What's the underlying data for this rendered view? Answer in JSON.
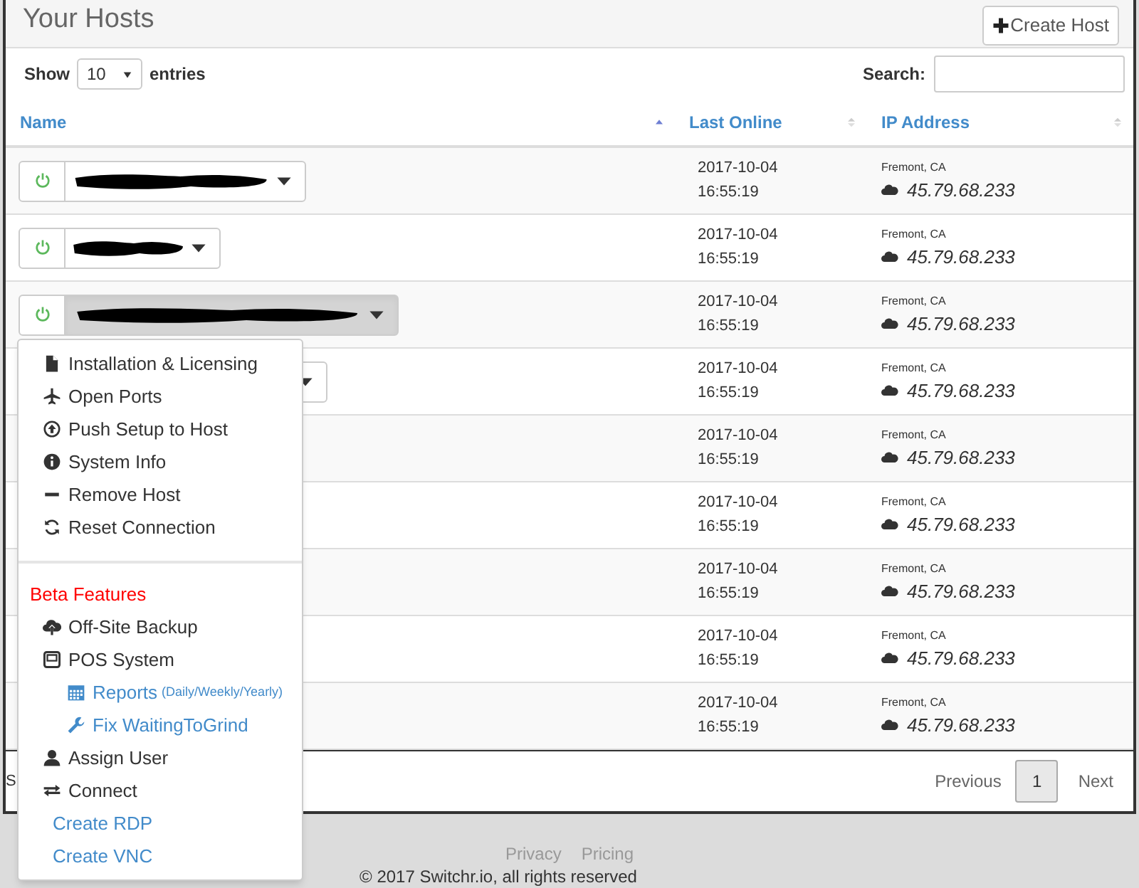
{
  "title": "Your Hosts",
  "create_button": {
    "label": "Create Host"
  },
  "length_control": {
    "before": "Show",
    "value": "10",
    "after": "entries"
  },
  "search": {
    "label": "Search:"
  },
  "table": {
    "columns": [
      {
        "label": "Name",
        "sorted": true
      },
      {
        "label": "Last Online",
        "sorted": false
      },
      {
        "label": "IP Address",
        "sorted": false
      }
    ],
    "rows": [
      {
        "kind": "button",
        "expanded": false,
        "date": "2017-10-04",
        "time": "16:55:19",
        "location": "Fremont, CA",
        "ip": "45.79.68.233"
      },
      {
        "kind": "button",
        "expanded": false,
        "date": "2017-10-04",
        "time": "16:55:19",
        "location": "Fremont, CA",
        "ip": "45.79.68.233"
      },
      {
        "kind": "button",
        "expanded": true,
        "date": "2017-10-04",
        "time": "16:55:19",
        "location": "Fremont, CA",
        "ip": "45.79.68.233"
      },
      {
        "kind": "covered_button",
        "date": "2017-10-04",
        "time": "16:55:19",
        "location": "Fremont, CA",
        "ip": "45.79.68.233"
      },
      {
        "date": "2017-10-04",
        "time": "16:55:19",
        "location": "Fremont, CA",
        "ip": "45.79.68.233"
      },
      {
        "date": "2017-10-04",
        "time": "16:55:19",
        "location": "Fremont, CA",
        "ip": "45.79.68.233"
      },
      {
        "date": "2017-10-04",
        "time": "16:55:19",
        "location": "Fremont, CA",
        "ip": "45.79.68.233"
      },
      {
        "date": "2017-10-04",
        "time": "16:55:19",
        "location": "Fremont, CA",
        "ip": "45.79.68.233"
      },
      {
        "date": "2017-10-04",
        "time": "16:55:19",
        "location": "Fremont, CA",
        "ip": "45.79.68.233"
      }
    ]
  },
  "info": "S",
  "pagination": {
    "previous": "Previous",
    "pages": [
      {
        "label": "1",
        "selected": true
      }
    ],
    "next": "Next"
  },
  "dropdown_menu": [
    {
      "kind": "item",
      "label": "Installation & Licensing"
    },
    {
      "kind": "item",
      "label": "Open Ports"
    },
    {
      "kind": "item",
      "label": "Push Setup to Host"
    },
    {
      "kind": "item",
      "label": "System Info"
    },
    {
      "kind": "item",
      "label": "Remove Host"
    },
    {
      "kind": "item",
      "label": "Reset Connection"
    },
    {
      "kind": "divider"
    },
    {
      "kind": "header",
      "label": "Beta Features"
    },
    {
      "kind": "item",
      "label": "Off-Site Backup"
    },
    {
      "kind": "item",
      "label": "POS System"
    },
    {
      "kind": "subitem",
      "label": "Reports",
      "note": "(Daily/Weekly/Yearly)"
    },
    {
      "kind": "subitem",
      "label": "Fix WaitingToGrind"
    },
    {
      "kind": "item",
      "label": "Assign User"
    },
    {
      "kind": "item",
      "label": "Connect"
    },
    {
      "kind": "link",
      "label": "Create RDP"
    },
    {
      "kind": "link",
      "label": "Create VNC"
    }
  ],
  "footer": {
    "links": [
      "Privacy",
      "Pricing"
    ],
    "copyright": "© 2017 Switchr.io, all rights reserved"
  }
}
